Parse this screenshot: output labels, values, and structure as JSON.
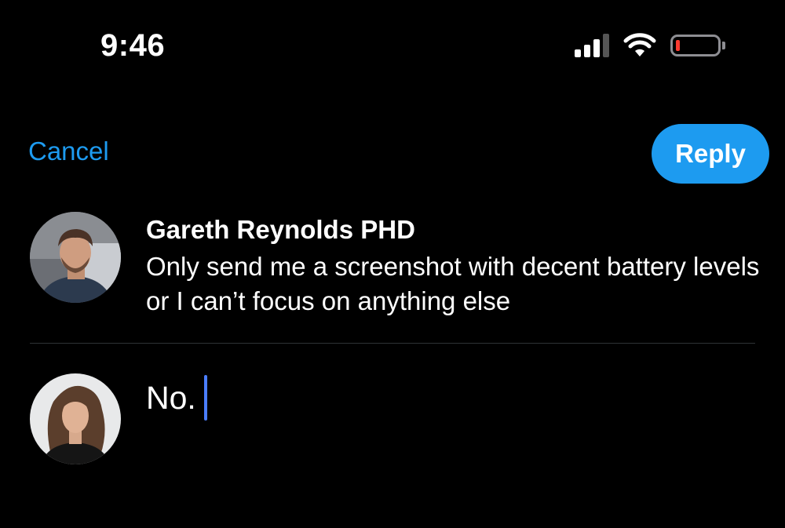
{
  "status_bar": {
    "time": "9:46",
    "battery_color": "#ff3b30"
  },
  "header": {
    "cancel_label": "Cancel",
    "reply_label": "Reply",
    "accent_color": "#1d9bf0"
  },
  "original_post": {
    "author": "Gareth Reynolds PHD",
    "text": "Only send me a screenshot with decent battery levels or I can’t focus on anything else",
    "avatar_icon": "user-avatar-man"
  },
  "reply": {
    "value": "No.",
    "avatar_icon": "user-avatar-woman"
  }
}
